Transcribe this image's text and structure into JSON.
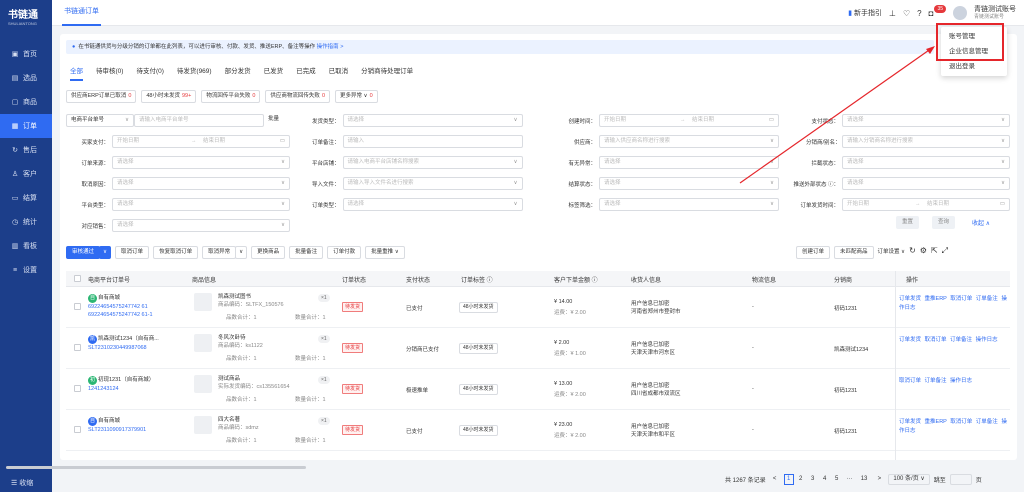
{
  "app": {
    "logo": "书链通",
    "logo_sub": "SHULIANTONG"
  },
  "sidebar": {
    "items": [
      {
        "label": "首页",
        "icon": "▣"
      },
      {
        "label": "选品",
        "icon": "▤"
      },
      {
        "label": "商品",
        "icon": "▢"
      },
      {
        "label": "订单",
        "icon": "▦",
        "active": true
      },
      {
        "label": "售后",
        "icon": "↻"
      },
      {
        "label": "客户",
        "icon": "♙"
      },
      {
        "label": "结算",
        "icon": "▭"
      },
      {
        "label": "统计",
        "icon": "◷"
      },
      {
        "label": "看板",
        "icon": "▥"
      },
      {
        "label": "设置",
        "icon": "≡"
      }
    ],
    "collapse_label": "收缩",
    "collapse_icon": "☰"
  },
  "topbar": {
    "tab": "书链通订单",
    "guide": "新手指引",
    "badge": "35",
    "account_name": "青链测试账号",
    "account_role": "青链测试账号"
  },
  "dropdown": {
    "items": [
      "账号管理",
      "企业信息管理",
      "退出登录"
    ]
  },
  "notice": {
    "icon": "i",
    "text": "在书链通供货与分级分销的订单都在此列表，可以进行审核、付款、发货、推送ERP、备注等操作",
    "link": "操作指南 >"
  },
  "status_tabs": [
    "全部",
    "待审核(0)",
    "待支付(0)",
    "待发货(969)",
    "部分发货",
    "已发货",
    "已完成",
    "已取消",
    "分销商待处理订单"
  ],
  "chips": [
    {
      "label": "供应商ERP订单已取消",
      "count": "0"
    },
    {
      "label": "48小时未发货",
      "count": "99+"
    },
    {
      "label": "物流回传平台失败",
      "count": "0"
    },
    {
      "label": "供应商物流回传失败",
      "count": "0"
    },
    {
      "label": "更多异常 ∨",
      "count": "0"
    }
  ],
  "filters": {
    "platform_order_label": "电商平台单号",
    "platform_order_ph": "请输入电商平台单号",
    "batch": "批量",
    "ship_type": "发货类型：",
    "ship_type_ph": "请选择",
    "created_time": "创建时间：",
    "start": "开始日期",
    "end": "结束日期",
    "arrow": "→",
    "pay_status": "支付状态：",
    "select_ph": "请选择",
    "buyer_pay": "买家支付：",
    "order_note": "订单备注：",
    "order_note_ph": "请输入",
    "supplier": "供应商：",
    "supplier_ph": "请输入供应商名称进行搜索",
    "distributor": "分销商/别名：",
    "distributor_ph": "请输入分销商名称进行搜索",
    "order_source": "订单来源：",
    "platform_shop": "平台店铺：",
    "platform_shop_ph": "请输入电商平台店铺名称搜索",
    "has_abnormal": "有无异常：",
    "intercept": "拦截状态：",
    "cancel_reason": "取消原因：",
    "import_file": "导入文件：",
    "import_file_ph": "请输入导入文件名进行搜索",
    "settle_status": "结算状态：",
    "push_status": "推送外部状态 ⓘ：",
    "platform_type": "平台类型：",
    "order_type": "订单类型：",
    "tag_filter": "标签筛选：",
    "order_ship_time": "订单发货时间：",
    "sales_owner": "对应销售：",
    "reset": "重置",
    "query": "查询",
    "collapse": "收起 ∧"
  },
  "actions": {
    "audit": "审核通过",
    "audit_more": "∨",
    "cancel": "取消订单",
    "restore": "恢复取消订单",
    "cancel_abn": "取消异常",
    "cancel_abn_more": "∨",
    "change_product": "更换商品",
    "batch_note": "批量备注",
    "pay": "订单付款",
    "batch_repush": "批量重推 ∨",
    "create": "创建订单",
    "unmatched": "未匹配商品",
    "col_settings": "订单设置 ∨"
  },
  "table": {
    "headers": [
      "电商平台订单号",
      "商品信息",
      "订单状态",
      "支付状态",
      "订单标签 ⓘ",
      "客户下单金额 ⓘ",
      "收货人信息",
      "物流信息",
      "分销商",
      "操作"
    ],
    "rows": [
      {
        "shop": "自有商城",
        "shop_ic": "自",
        "order1": "69224654575247742 61",
        "order2": "69224654575247742 61-1",
        "product": "凯森测试图书",
        "code": "商品编码：SLTFX_150576",
        "qty": "×1",
        "variety": "品数合计：1",
        "count": "数量合计：1",
        "status": "待发货",
        "pay": "已支付",
        "tag": "48小时未发货",
        "amount": "¥ 14.00",
        "freight": "运费：¥ 2.00",
        "recv1": "用户信息已加密",
        "recv2": "河南省郑州市登封市",
        "logistics": "-",
        "distributor": "初码1231",
        "ops": "订单发货 重推ERP 取消订单 订单备注 操作日志"
      },
      {
        "shop": "凯森测试1234（自有商...",
        "shop_ic": "凯",
        "order1": "SLT2310230449987068",
        "order2": "",
        "product": "冬风次卧待",
        "code": "商品编码：ks1122",
        "qty": "×1",
        "variety": "品数合计：1",
        "count": "数量合计：1",
        "status": "待发货",
        "pay": "分销商已支付",
        "tag": "48小时未发货",
        "amount": "¥ 2.00",
        "freight": "运费：¥ 1.00",
        "recv1": "用户信息已加密",
        "recv2": "天津天津市河东区",
        "logistics": "-",
        "distributor": "凯森测试1234",
        "ops": "订单发货 取消订单 订单备注 操作日志"
      },
      {
        "shop": "初现1231（自有商城）",
        "shop_ic": "初",
        "order1": "1241243124",
        "order2": "",
        "product": "测试商品",
        "code": "实际发货编码：cs135561654",
        "qty": "×1",
        "variety": "品数合计：1",
        "count": "数量合计：1",
        "status": "待发货",
        "pay": "极速推单",
        "tag": "48小时未发货",
        "amount": "¥ 13.00",
        "freight": "运费：¥ 2.00",
        "recv1": "用户信息已加密",
        "recv2": "四川省成都市双流区",
        "logistics": "-",
        "distributor": "初码1231",
        "ops": "取消订单 订单备注 操作日志"
      },
      {
        "shop": "自有商城",
        "shop_ic": "自",
        "order1": "SLT2311090917379901",
        "order2": "",
        "product": "四大名著",
        "code": "商品编码：sdmz",
        "qty": "×1",
        "variety": "品数合计：1",
        "count": "数量合计：1",
        "status": "待发货",
        "pay": "已支付",
        "tag": "48小时未发货",
        "amount": "¥ 23.00",
        "freight": "运费：¥ 2.00",
        "recv1": "用户信息已加密",
        "recv2": "天津天津市和平区",
        "logistics": "-",
        "distributor": "初码1231",
        "ops": "订单发货 重推ERP 取消订单 订单备注 操作日志"
      }
    ]
  },
  "pager": {
    "total": "共 1267 条记录",
    "prev": "<",
    "pages": [
      "1",
      "2",
      "3",
      "4",
      "5",
      "···",
      "13"
    ],
    "next": ">",
    "size": "100 条/页 ∨",
    "goto": "跳至",
    "page_unit": "页"
  },
  "colors": {
    "sidebar": "#1c3e8a",
    "accent": "#2f6bf2",
    "danger": "#e5383b"
  }
}
